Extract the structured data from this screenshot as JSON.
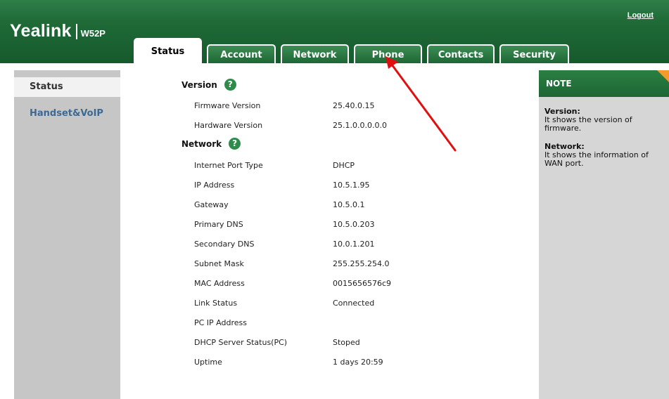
{
  "brand": {
    "name": "Yealink",
    "model": "W52P"
  },
  "header": {
    "logout_label": "Logout"
  },
  "tabs": [
    {
      "label": "Status",
      "active": true
    },
    {
      "label": "Account",
      "active": false
    },
    {
      "label": "Network",
      "active": false
    },
    {
      "label": "Phone",
      "active": false
    },
    {
      "label": "Contacts",
      "active": false
    },
    {
      "label": "Security",
      "active": false
    }
  ],
  "sidebar": {
    "items": [
      {
        "label": "Status",
        "active": true
      },
      {
        "label": "Handset&VoIP",
        "active": false
      }
    ]
  },
  "main": {
    "version_section": {
      "title": "Version",
      "help_icon": "?"
    },
    "version_rows": [
      {
        "label": "Firmware Version",
        "value": "25.40.0.15"
      },
      {
        "label": "Hardware Version",
        "value": "25.1.0.0.0.0.0"
      }
    ],
    "network_section": {
      "title": "Network",
      "help_icon": "?"
    },
    "network_rows": [
      {
        "label": "Internet Port Type",
        "value": "DHCP"
      },
      {
        "label": "IP Address",
        "value": "10.5.1.95"
      },
      {
        "label": "Gateway",
        "value": "10.5.0.1"
      },
      {
        "label": "Primary DNS",
        "value": "10.5.0.203"
      },
      {
        "label": "Secondary DNS",
        "value": "10.0.1.201"
      },
      {
        "label": "Subnet Mask",
        "value": "255.255.254.0"
      },
      {
        "label": "MAC Address",
        "value": "0015656576c9"
      },
      {
        "label": "Link Status",
        "value": "Connected"
      },
      {
        "label": "PC IP Address",
        "value": ""
      },
      {
        "label": "DHCP Server Status(PC)",
        "value": "Stoped"
      },
      {
        "label": "Uptime",
        "value": "1 days 20:59"
      }
    ]
  },
  "note": {
    "title": "NOTE",
    "entries": [
      {
        "term": "Version:",
        "text": "It shows the version of firmware."
      },
      {
        "term": "Network:",
        "text": "It shows the information of WAN port."
      }
    ]
  },
  "colors": {
    "header_green": "#1f6a37",
    "tab_green": "#2f8046",
    "sidebar_gray": "#c6c6c6",
    "note_gray": "#d6d6d6",
    "link_blue": "#3b6a97",
    "note_corner_orange": "#f39a2a",
    "annotation_arrow": "#e01010"
  },
  "icons": {
    "help": "help-icon",
    "arrow": "red-arrow-annotation"
  }
}
